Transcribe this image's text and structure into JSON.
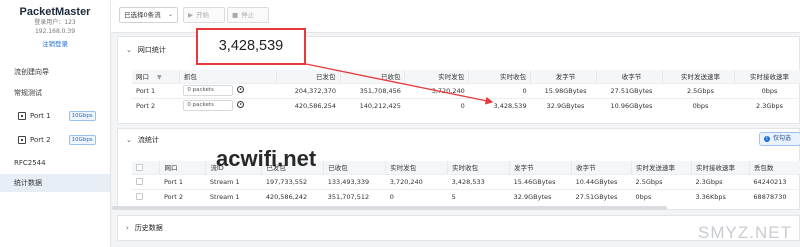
{
  "sidebar": {
    "brand": "PacketMaster",
    "user": "登录用户：123",
    "ip": "192.168.0.39",
    "logout": "注销登录",
    "items": [
      {
        "label": "流创建向导"
      },
      {
        "label": "常规测试"
      },
      {
        "label": "Port 1",
        "speed": "10Gbps"
      },
      {
        "label": "Port 2",
        "speed": "10Gbps"
      },
      {
        "label": "RFC2544"
      },
      {
        "label": "统计数据"
      }
    ]
  },
  "toolbar": {
    "select_label": "已选择0条流",
    "start_label": "开始",
    "stop_label": "停止"
  },
  "port_stats": {
    "title": "网口统计",
    "headers": [
      "网口",
      "抓包",
      "已发包",
      "已收包",
      "实时发包",
      "实时收包",
      "发字节",
      "收字节",
      "实时发送速率",
      "实时接收速率"
    ],
    "rows": [
      {
        "port": "Port 1",
        "capture": "0 packets",
        "sent": "204,372,370",
        "recv": "351,708,456",
        "rt_sent": "3,720,240",
        "rt_recv": "0",
        "sent_bytes": "15.98GBytes",
        "recv_bytes": "27.51GBytes",
        "rt_tx_rate": "2.5Gbps",
        "rt_rx_rate": "0bps"
      },
      {
        "port": "Port 2",
        "capture": "0 packets",
        "sent": "420,586,254",
        "recv": "140,212,425",
        "rt_sent": "0",
        "rt_recv": "3,428,539",
        "sent_bytes": "32.9GBytes",
        "recv_bytes": "10.96GBytes",
        "rt_tx_rate": "0bps",
        "rt_rx_rate": "2.3Gbps"
      }
    ],
    "highlight_value": "3,428,539"
  },
  "flow_stats": {
    "title": "流统计",
    "info_btn": "仅勾选",
    "headers": [
      "网口",
      "流ID",
      "已发包",
      "已收包",
      "实时发包",
      "实时收包",
      "发字节",
      "收字节",
      "实时发送速率",
      "实时接收速率",
      "丢包数"
    ],
    "rows": [
      {
        "port": "Port 1",
        "flow": "Stream 1",
        "sent": "197,733,552",
        "recv": "133,493,339",
        "rt_sent": "3,720,240",
        "rt_recv": "3,428,533",
        "sent_bytes": "15.46GBytes",
        "recv_bytes": "10.44GBytes",
        "rt_tx_rate": "2.5Gbps",
        "rt_rx_rate": "2.3Gbps",
        "lost": "64240213"
      },
      {
        "port": "Port 2",
        "flow": "Stream 1",
        "sent": "420,586,242",
        "recv": "351,707,512",
        "rt_sent": "0",
        "rt_recv": "5",
        "sent_bytes": "32.9GBytes",
        "recv_bytes": "27.51GBytes",
        "rt_tx_rate": "0bps",
        "rt_rx_rate": "3.36Kbps",
        "lost": "68878730"
      }
    ]
  },
  "history": {
    "title": "历史数据"
  },
  "watermarks": {
    "site": "acwifi.net",
    "corner": "SMYZ.NET"
  },
  "colors": {
    "accent": "#1f6fd1",
    "highlight_box": "#e8393a",
    "active_nav": "#e8eef6"
  }
}
